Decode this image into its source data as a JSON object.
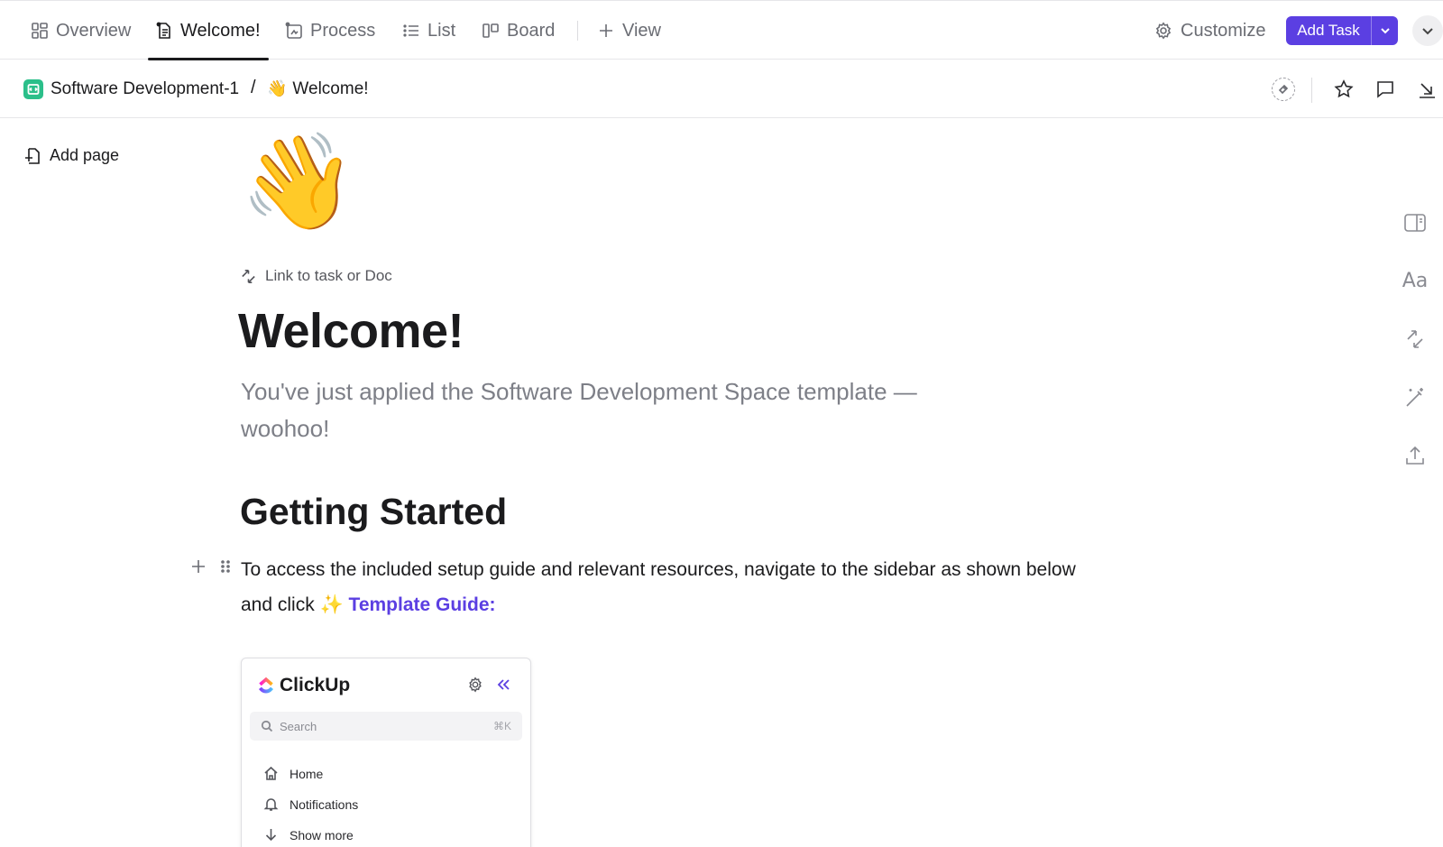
{
  "tabs": [
    {
      "label": "Overview",
      "icon": "overview-grid-icon",
      "active": false
    },
    {
      "label": "Welcome!",
      "icon": "doc-icon",
      "active": true
    },
    {
      "label": "Process",
      "icon": "whiteboard-icon",
      "active": false
    },
    {
      "label": "List",
      "icon": "list-icon",
      "active": false
    },
    {
      "label": "Board",
      "icon": "board-icon",
      "active": false
    },
    {
      "label": "View",
      "icon": "plus-icon",
      "active": false
    }
  ],
  "toolbar": {
    "customize_label": "Customize",
    "add_task_label": "Add Task",
    "accent_color": "#5b3fe2"
  },
  "breadcrumb": {
    "space": "Software Development-1",
    "separator": "/",
    "page_emoji": "👋",
    "page": "Welcome!"
  },
  "sidebar": {
    "add_page_label": "Add page"
  },
  "rail": {
    "font_label": "Aa"
  },
  "doc": {
    "emoji": "👋",
    "link_label": "Link to task or Doc",
    "title": "Welcome!",
    "subtitle": "You've just applied the Software Development Space template — woohoo!",
    "heading": "Getting Started",
    "paragraph_text": "To access the included setup guide and relevant resources, navigate to the sidebar as shown below and click ",
    "sparkle": "✨",
    "guide_link": "Template Guide:"
  },
  "embed": {
    "logo_text": "ClickUp",
    "search_placeholder": "Search",
    "search_shortcut": "⌘K",
    "items": [
      {
        "label": "Home",
        "icon": "home-icon"
      },
      {
        "label": "Notifications",
        "icon": "bell-icon"
      },
      {
        "label": "Show more",
        "icon": "arrow-down-icon"
      }
    ]
  }
}
